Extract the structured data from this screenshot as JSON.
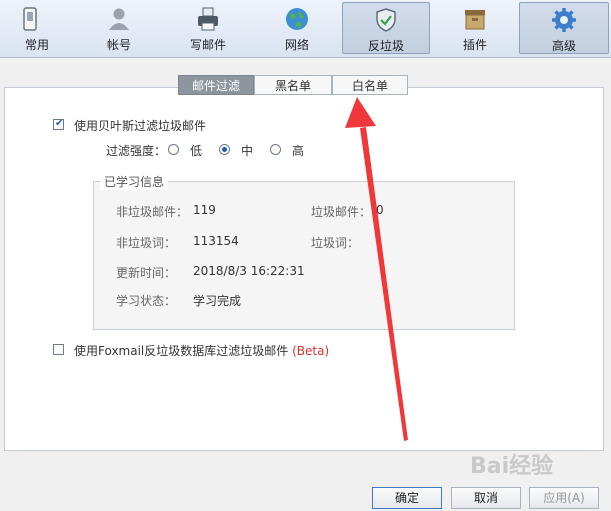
{
  "toolbar": {
    "items": [
      {
        "label": "常用",
        "icon": "phone-icon"
      },
      {
        "label": "帐号",
        "icon": "user-icon"
      },
      {
        "label": "写邮件",
        "icon": "printer-icon"
      },
      {
        "label": "网络",
        "icon": "globe-icon"
      },
      {
        "label": "反垃圾",
        "icon": "shield-icon",
        "active": true
      },
      {
        "label": "插件",
        "icon": "box-icon"
      },
      {
        "label": "高级",
        "icon": "gear-icon"
      }
    ]
  },
  "tabs": [
    {
      "label": "邮件过滤",
      "active": true
    },
    {
      "label": "黑名单"
    },
    {
      "label": "白名单"
    }
  ],
  "bayes": {
    "checkbox_label": "使用贝叶斯过滤垃圾邮件",
    "checked": true,
    "strength_label": "过滤强度：",
    "options": [
      {
        "label": "低",
        "selected": false
      },
      {
        "label": "中",
        "selected": true
      },
      {
        "label": "高",
        "selected": false
      }
    ]
  },
  "learned": {
    "title": "已学习信息",
    "nonspam_mail_label": "非垃圾邮件：",
    "nonspam_mail_value": "119",
    "spam_mail_label": "垃圾邮件：",
    "spam_mail_value": "0",
    "nonspam_word_label": "非垃圾词：",
    "nonspam_word_value": "113154",
    "spam_word_label": "垃圾词：",
    "spam_word_value": "",
    "update_label": "更新时间：",
    "update_value": "2018/8/3 16:22:31",
    "status_label": "学习状态：",
    "status_value": "学习完成"
  },
  "foxmail_db": {
    "checkbox_label": "使用Foxmail反垃圾数据库过滤垃圾邮件",
    "beta": "(Beta)",
    "checked": false
  },
  "buttons": {
    "ok": "确定",
    "cancel": "取消",
    "apply": "应用(A)"
  },
  "watermark": "Bai经验",
  "annotation_color": "#f0383a"
}
